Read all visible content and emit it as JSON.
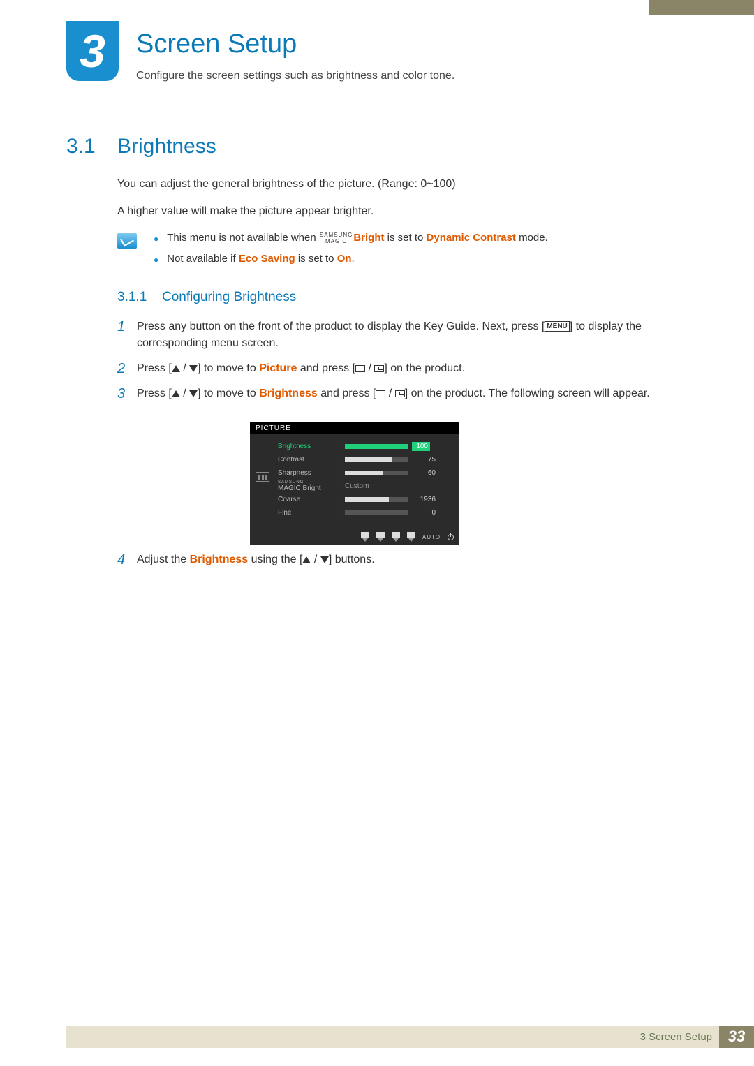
{
  "chapter": {
    "number": "3",
    "title": "Screen Setup",
    "description": "Configure the screen settings such as brightness and color tone."
  },
  "section": {
    "number": "3.1",
    "title": "Brightness",
    "p1": "You can adjust the general brightness of the picture. (Range: 0~100)",
    "p2": "A higher value will make the picture appear brighter."
  },
  "notes": {
    "n1a": "This menu is not available when ",
    "magic_top": "SAMSUNG",
    "magic_bottom": "MAGIC",
    "n1b": "Bright",
    "n1c": " is set to ",
    "n1d": "Dynamic Contrast",
    "n1e": " mode.",
    "n2a": "Not available if ",
    "n2b": "Eco Saving",
    "n2c": " is set to ",
    "n2d": "On",
    "n2e": "."
  },
  "subsection": {
    "number": "3.1.1",
    "title": "Configuring Brightness"
  },
  "steps": {
    "s1n": "1",
    "s1a": "Press any button on the front of the product to display the Key Guide. Next, press [",
    "s1menu": "MENU",
    "s1b": "] to display the corresponding menu screen.",
    "s2n": "2",
    "s2a": "Press [",
    "s2b": "] to move to ",
    "s2c": "Picture",
    "s2d": " and press [",
    "s2e": "] on the product.",
    "s3n": "3",
    "s3a": "Press [",
    "s3b": "] to move to ",
    "s3c": "Brightness",
    "s3d": " and press [",
    "s3e": "] on the product. The following screen will appear.",
    "s4n": "4",
    "s4a": "Adjust the ",
    "s4b": "Brightness",
    "s4c": " using the [",
    "s4d": "] buttons."
  },
  "osd": {
    "title": "PICTURE",
    "rows": [
      {
        "label": "Brightness",
        "active": true,
        "value": "100",
        "fill": 100
      },
      {
        "label": "Contrast",
        "value": "75",
        "fill": 75
      },
      {
        "label": "Sharpness",
        "value": "60",
        "fill": 60
      },
      {
        "label": "MAGIC Bright",
        "samsung": "SAMSUNG",
        "text": "Custom"
      },
      {
        "label": "Coarse",
        "value": "1936",
        "fill": 70
      },
      {
        "label": "Fine",
        "value": "0",
        "fill": 0
      }
    ],
    "auto": "AUTO"
  },
  "footer": {
    "label": "3 Screen Setup",
    "page": "33"
  }
}
